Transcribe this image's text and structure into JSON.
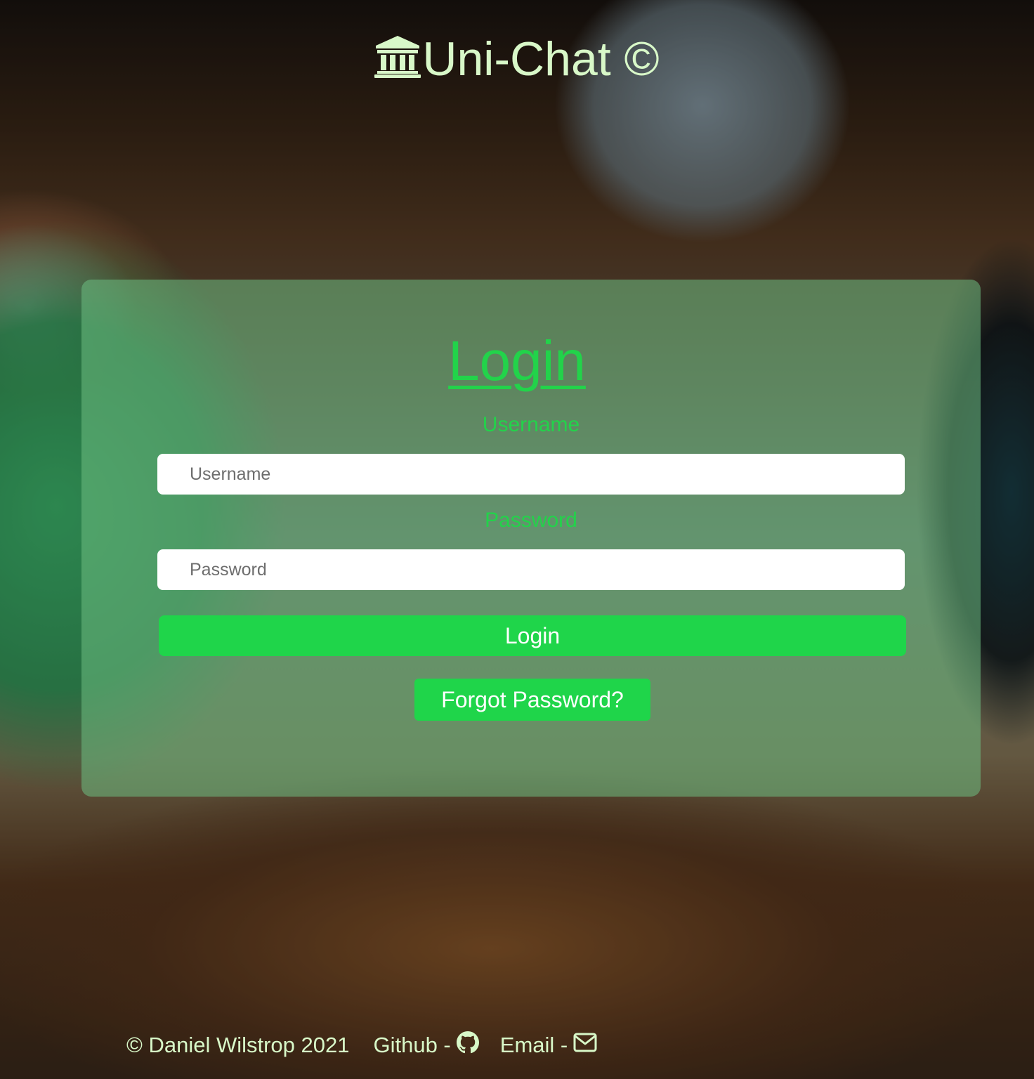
{
  "theme": {
    "brand_color": "#d8f8c8",
    "accent_green": "#1fd54a",
    "label_green": "#22d34a"
  },
  "header": {
    "icon": "bank-icon",
    "title": "Uni-Chat ©"
  },
  "login": {
    "title": "Login",
    "username_label": "Username",
    "username_placeholder": "Username",
    "username_value": "",
    "password_label": "Password",
    "password_placeholder": "Password",
    "password_value": "",
    "login_button": "Login",
    "forgot_button": "Forgot Password?"
  },
  "footer": {
    "copyright": "© Daniel Wilstrop 2021",
    "github_label": "Github -",
    "github_icon": "github-icon",
    "email_label": "Email -",
    "email_icon": "envelope-icon"
  }
}
